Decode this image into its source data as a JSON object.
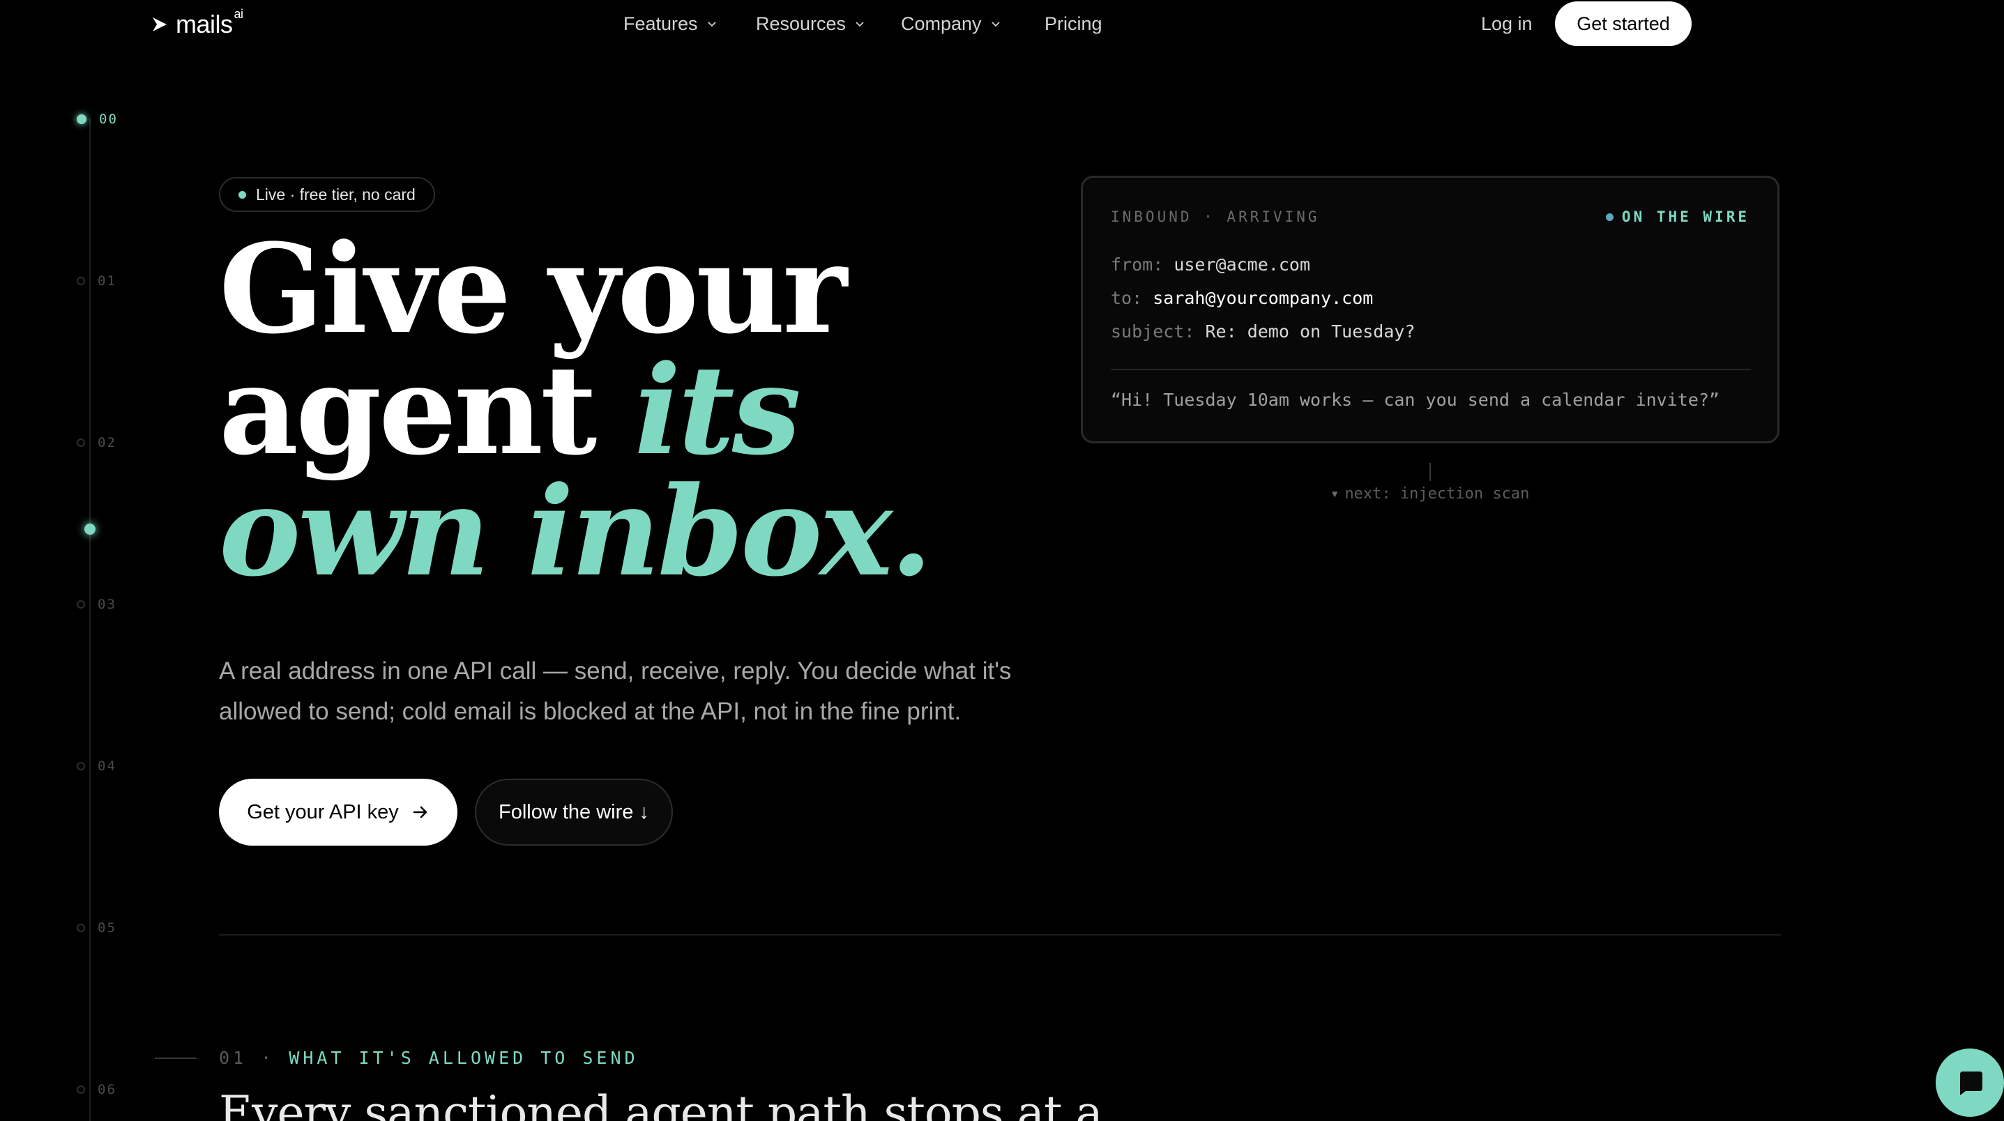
{
  "nav": {
    "logo_text": "mails",
    "logo_sup": "ai",
    "items": [
      {
        "label": "Features",
        "has_dropdown": true
      },
      {
        "label": "Resources",
        "has_dropdown": true
      },
      {
        "label": "Company",
        "has_dropdown": true
      },
      {
        "label": "Pricing",
        "has_dropdown": false
      }
    ],
    "login_label": "Log in",
    "cta_label": "Get started"
  },
  "rail": {
    "steps": [
      "00",
      "01",
      "02",
      "03",
      "04",
      "05",
      "06"
    ],
    "active_step": "00"
  },
  "hero": {
    "pill_text": "Live · free tier, no card",
    "headline": {
      "line1": "Give your",
      "line2_plain": "agent ",
      "line2_accent": "its",
      "line3_accent": "own inbox."
    },
    "subtext": "A real address in one API call — send, receive, reply. You decide what it's allowed to send; cold email is blocked at the API, not in the fine print.",
    "primary_button": "Get your API key",
    "secondary_button": "Follow the wire ↓"
  },
  "wire_card": {
    "title": "INBOUND · ARRIVING",
    "status": "ON THE WIRE",
    "fields": [
      {
        "key": "from:",
        "value": "user@acme.com"
      },
      {
        "key": "to:",
        "value": "sarah@yourcompany.com"
      },
      {
        "key": "subject:",
        "value": "Re: demo on Tuesday?"
      }
    ],
    "body": "“Hi! Tuesday 10am works — can you send a calendar invite?”",
    "next_label": "next: injection scan"
  },
  "section": {
    "number": "01",
    "separator": "·",
    "label": "WHAT IT'S ALLOWED TO SEND",
    "title": "Every sanctioned agent path stops at a"
  },
  "colors": {
    "accent": "#7fd9c2",
    "background": "#000000",
    "status_dot": "#5aa8c2"
  },
  "icons": {
    "logo": "chevron-right-icon",
    "dropdown": "chevron-down-icon",
    "primary_arrow": "arrow-right-icon",
    "chat": "chat-bubble-icon"
  }
}
